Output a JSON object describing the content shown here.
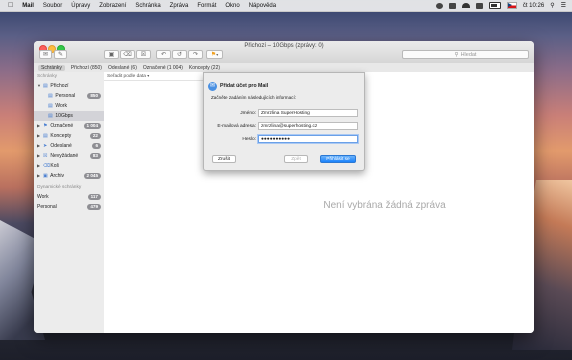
{
  "menubar": {
    "items": [
      "Mail",
      "Soubor",
      "Úpravy",
      "Zobrazení",
      "Schránka",
      "Zpráva",
      "Formát",
      "Okno",
      "Nápověda"
    ],
    "clock": "čt 10:26"
  },
  "window": {
    "title": "Přichozí – 10Gbps (zprávy: 0)",
    "search_placeholder": "Hledat"
  },
  "favorites_bar": {
    "items": [
      "Schránky",
      "Přichozí (850)",
      "Odeslané (6)",
      "Označené (1 004)",
      "Koncepty (22)"
    ]
  },
  "sidebar": {
    "header": "Schránky",
    "inbox": "Přichozí",
    "inbox_children": [
      {
        "label": "Personal",
        "badge": "850"
      },
      {
        "label": "Work",
        "badge": ""
      },
      {
        "label": "10Gbps",
        "badge": ""
      }
    ],
    "folders": [
      {
        "label": "Označené",
        "badge": "1 004"
      },
      {
        "label": "Koncepty",
        "badge": "22"
      },
      {
        "label": "Odeslané",
        "badge": "6"
      },
      {
        "label": "Nevyžádané",
        "badge": "83"
      },
      {
        "label": "Koš",
        "badge": ""
      },
      {
        "label": "Archiv",
        "badge": "2 045"
      }
    ],
    "smart_header": "Dynamické schránky",
    "smart": [
      {
        "label": "Work",
        "badge": "117"
      },
      {
        "label": "Personal",
        "badge": "479"
      }
    ]
  },
  "message_list": {
    "sort_label": "Seřadit podle data"
  },
  "content": {
    "empty_text": "Není vybrána žádná zpráva"
  },
  "dialog": {
    "title": "Přidat účet pro Mail",
    "subtitle": "Začněte zadáním následujících informací:",
    "name_label": "Jméno:",
    "name_value": "Zmrzlina SuperHosting",
    "email_label": "E-mailová adresa:",
    "email_value": "zmrzlina@superhosting.cz",
    "password_label": "Heslo:",
    "password_value": "●●●●●●●●●●",
    "cancel": "Zrušit",
    "back": "Zpět",
    "signin": "Přihlásit se"
  }
}
